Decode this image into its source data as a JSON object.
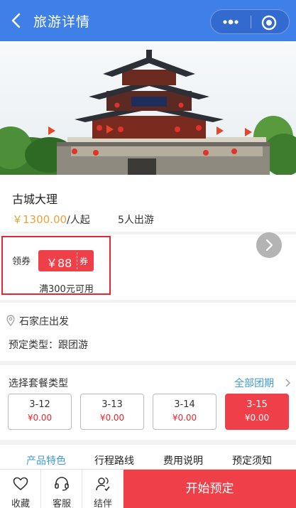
{
  "navbar": {
    "title": "旅游详情"
  },
  "trip": {
    "title": "古城大理",
    "price": "￥1300.00",
    "price_unit": "/人起",
    "min_people": "5人出游"
  },
  "coupon": {
    "label": "领券",
    "amount": "￥88",
    "tag": "券",
    "condition": "满300元可用"
  },
  "departure": {
    "city": "石家庄出发",
    "booking_type": "预定类型：跟团游"
  },
  "package": {
    "title": "选择套餐类型",
    "all_dates": "全部团期",
    "dates": [
      {
        "date": "3-12",
        "price": "¥0.00",
        "selected": false
      },
      {
        "date": "3-13",
        "price": "¥0.00",
        "selected": false
      },
      {
        "date": "3-14",
        "price": "¥0.00",
        "selected": false
      },
      {
        "date": "3-15",
        "price": "¥0.00",
        "selected": true
      }
    ]
  },
  "tabs": [
    {
      "label": "产品特色",
      "active": true
    },
    {
      "label": "行程路线",
      "active": false
    },
    {
      "label": "费用说明",
      "active": false
    },
    {
      "label": "预定须知",
      "active": false
    }
  ],
  "bottom_bar": {
    "favorite": "收藏",
    "service": "客服",
    "companion": "结伴",
    "book": "开始预定"
  },
  "colors": {
    "nav_blue": "#3f7fe8",
    "accent_red": "#ef3f48",
    "price_orange": "#e8a23a",
    "link_blue": "#3f9bd6"
  },
  "icons": [
    "back-icon",
    "more-icon",
    "close-target-icon",
    "chevron-right-icon",
    "location-pin-icon",
    "heart-icon",
    "headset-icon",
    "companion-icon"
  ]
}
